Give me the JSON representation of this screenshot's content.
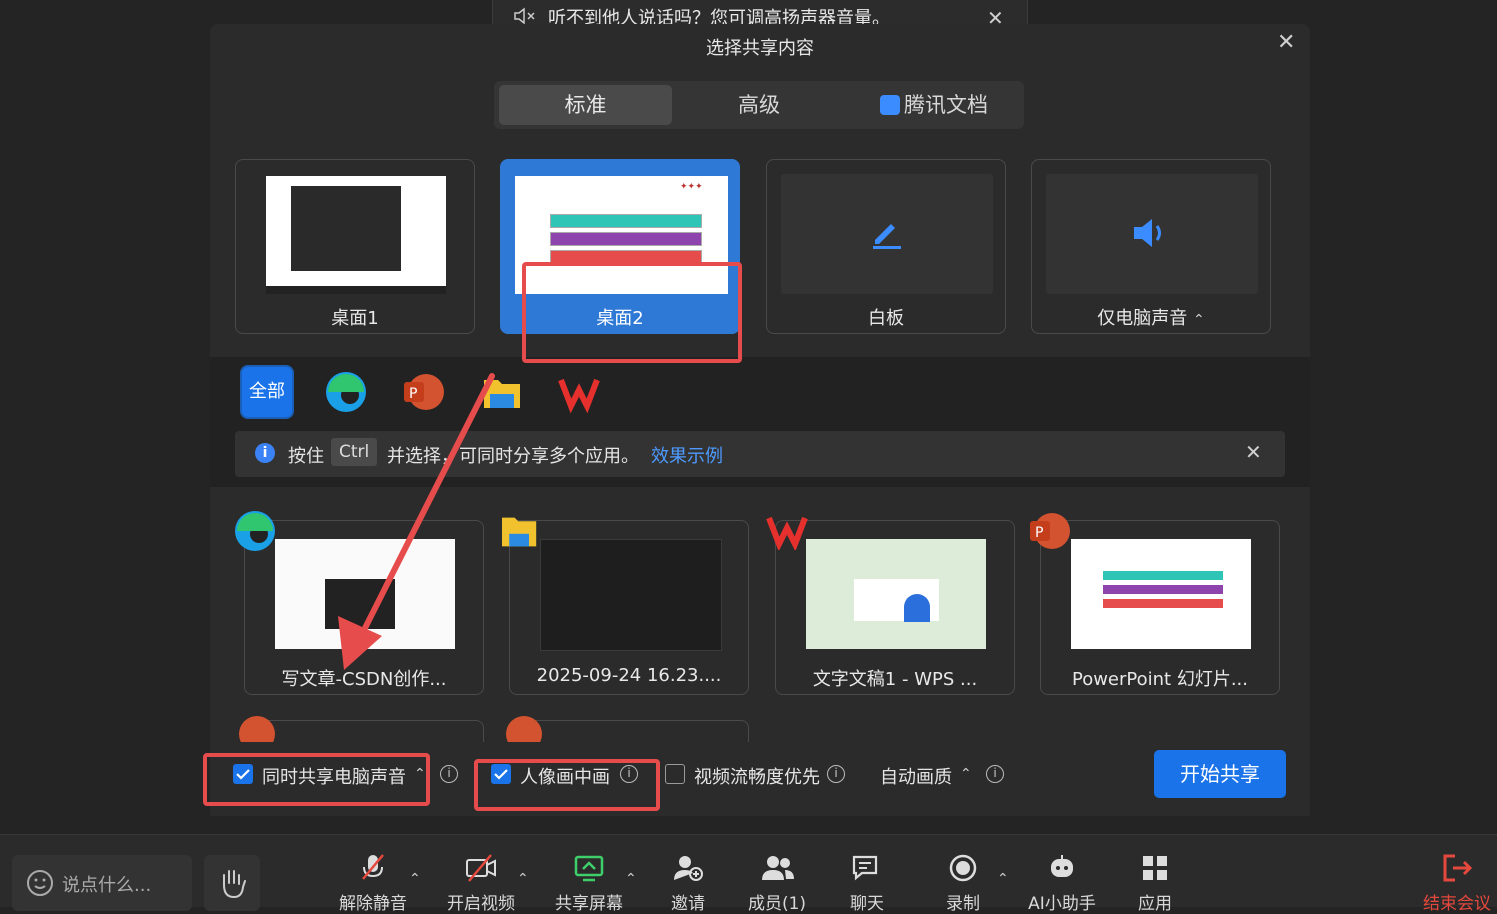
{
  "notification": {
    "text": "听不到他人说话吗？您可调高扬声器音量。",
    "close": "✕"
  },
  "dialog": {
    "title": "选择共享内容",
    "close": "✕",
    "tabs": [
      {
        "label": "标准"
      },
      {
        "label": "高级"
      },
      {
        "label": "腾讯文档"
      }
    ],
    "screens": [
      {
        "label": "桌面1"
      },
      {
        "label": "桌面2"
      },
      {
        "label": "白板"
      },
      {
        "label": "仅电脑声音",
        "caret": "⌃"
      }
    ],
    "filter_all": "全部",
    "hint": {
      "info": "i",
      "prefix": "按住",
      "key": "Ctrl",
      "suffix": "并选择，可同时分享多个应用。",
      "link": "效果示例",
      "close": "✕"
    },
    "windows": [
      {
        "label": "写文章-CSDN创作..."
      },
      {
        "label": "2025-09-24 16.23...."
      },
      {
        "label": "文字文稿1 - WPS ..."
      },
      {
        "label": "PowerPoint 幻灯片..."
      }
    ],
    "options": {
      "share_audio": "同时共享电脑声音",
      "pip": "人像画中画",
      "fluency": "视频流畅度优先",
      "quality": "自动画质",
      "caret": "⌃"
    },
    "start_button": "开始共享"
  },
  "toolbar": {
    "say_placeholder": "说点什么...",
    "caret": "⌃",
    "items": [
      {
        "label": "解除静音"
      },
      {
        "label": "开启视频"
      },
      {
        "label": "共享屏幕"
      },
      {
        "label": "邀请"
      },
      {
        "label": "成员(1)"
      },
      {
        "label": "聊天"
      },
      {
        "label": "录制"
      },
      {
        "label": "AI小助手"
      },
      {
        "label": "应用"
      },
      {
        "label": "结束会议"
      }
    ]
  },
  "colors": {
    "accent": "#1a73e8",
    "annotation": "#e74c4c",
    "end": "#e5483c"
  }
}
